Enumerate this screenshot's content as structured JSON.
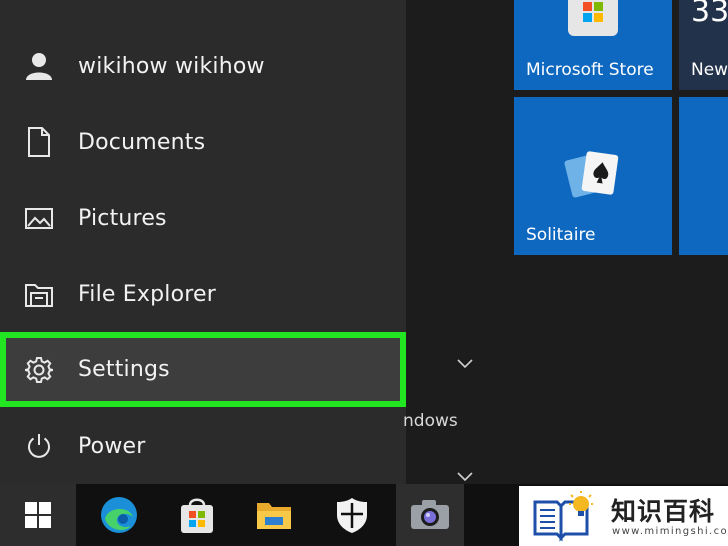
{
  "start_menu": {
    "items": [
      {
        "label": "wikihow wikihow",
        "icon": "user-icon"
      },
      {
        "label": "Documents",
        "icon": "document-icon"
      },
      {
        "label": "Pictures",
        "icon": "pictures-icon"
      },
      {
        "label": "File Explorer",
        "icon": "folder-icon"
      },
      {
        "label": "Settings",
        "icon": "gear-icon"
      },
      {
        "label": "Power",
        "icon": "power-icon"
      }
    ],
    "partial_group_text": "ndows"
  },
  "tiles": {
    "store": {
      "label": "Microsoft Store",
      "icon": "store-icon"
    },
    "news": {
      "label": "New",
      "number": "33"
    },
    "solitaire": {
      "label": "Solitaire",
      "icon": "cards-icon"
    }
  },
  "taskbar": {
    "apps": [
      "windows-start-icon",
      "edge-icon",
      "store-icon",
      "file-explorer-icon",
      "security-shield-icon",
      "camera-icon"
    ]
  },
  "colors": {
    "highlight": "#21e621",
    "tile": "#0f68c0",
    "menu": "#2b2b2b"
  },
  "watermark": {
    "title": "知识百科",
    "url": "www.mimingshi.com"
  }
}
